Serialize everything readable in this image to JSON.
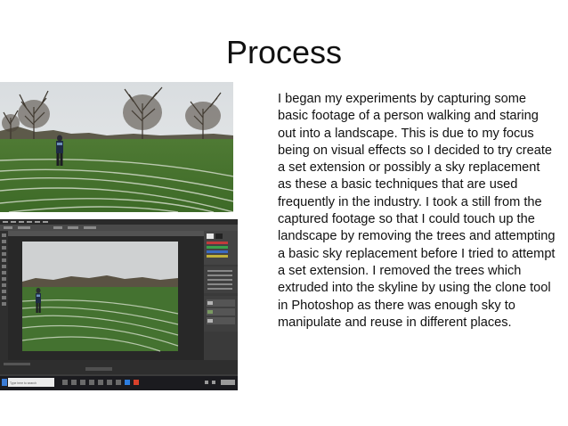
{
  "slide": {
    "title": "Process",
    "paragraph": "I began my experiments by capturing some basic footage of a person walking and staring out into a landscape. This is due to my focus being on visual effects so I decided to try create a set extension or possibly a sky replacement as these a basic techniques that are used frequently in the industry. I took a still from the captured footage so that I could touch up the landscape by removing the trees and attempting a basic sky replacement before I tried to attempt a set extension. I removed the trees which extruded into the skyline by using the clone tool in Photoshop as there was enough sky to manipulate and reuse in different places."
  },
  "photos": [
    {
      "subject": "person-standing-on-sports-field-with-trees"
    },
    {
      "subject": "photoshop-editing-sky-replacement"
    }
  ],
  "taskbar": {
    "search_placeholder": "Type here to search"
  }
}
